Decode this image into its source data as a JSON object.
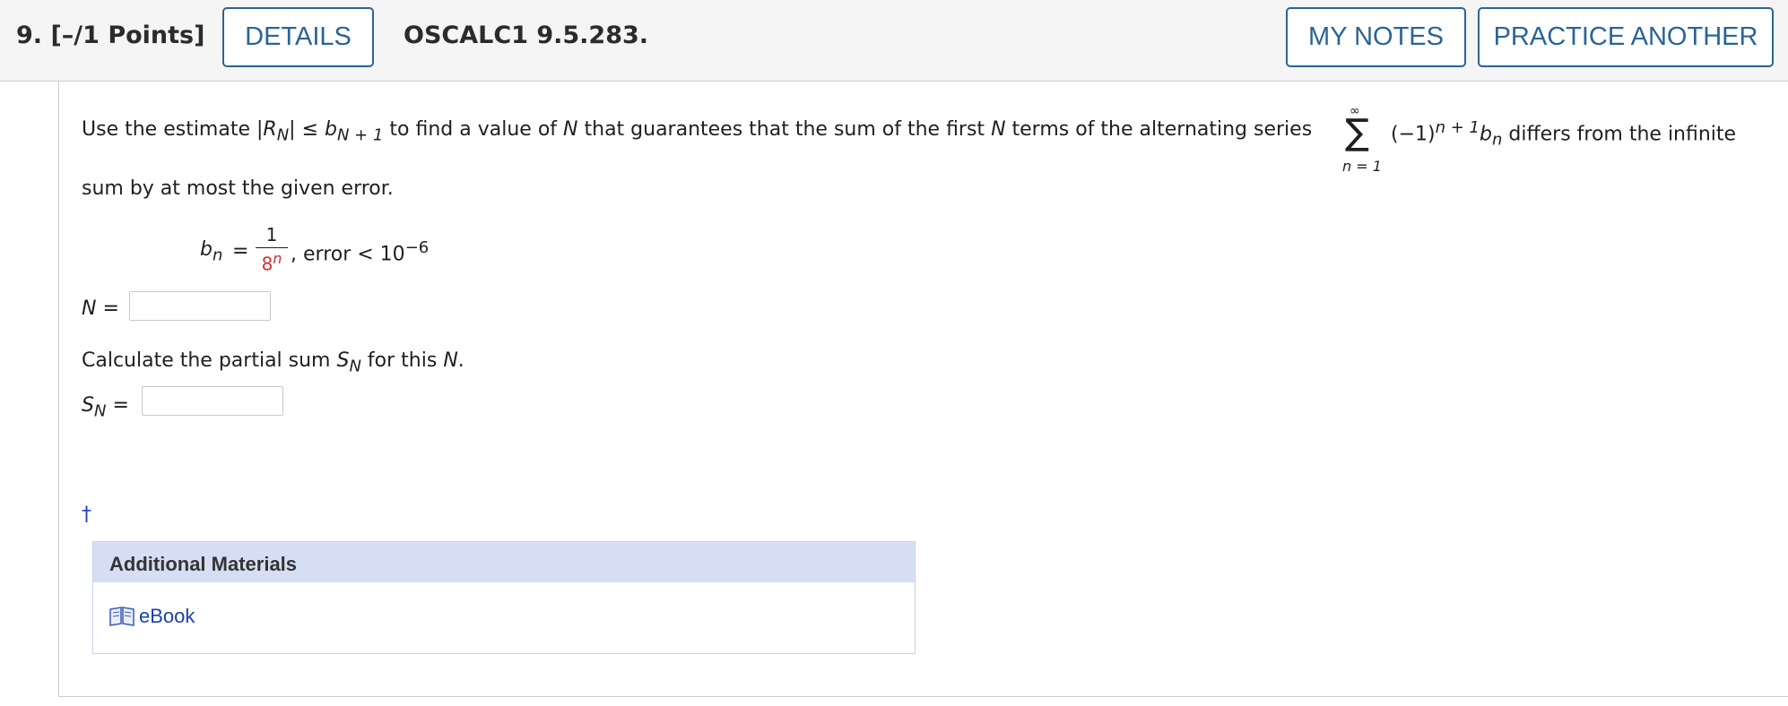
{
  "header": {
    "question_number": "9.",
    "points": "[–/1 Points]",
    "details_label": "DETAILS",
    "code": "OSCALC1 9.5.283.",
    "my_notes_label": "MY NOTES",
    "practice_label": "PRACTICE ANOTHER"
  },
  "problem": {
    "use_the_estimate": "Use the estimate |",
    "R": "R",
    "N_sub1": "N",
    "le_b": "| ≤ ",
    "b": "b",
    "N_plus_1": "N + 1",
    "to_find": " to find a value of ",
    "N1": "N",
    "guarantees": " that guarantees that the sum of the first ",
    "N2": "N",
    "terms": " terms of the alternating series",
    "sigma_top": "∞",
    "sigma": "∑",
    "sigma_bottom": "n = 1",
    "series_term": "(−1)",
    "series_exp": "n + 1",
    "series_b": "b",
    "series_b_sub": "n",
    "differs": " differs from the infinite",
    "line2": "sum by at most the given error.",
    "bn_b": "b",
    "bn_sub": "n",
    "equals": "=",
    "frac_num": "1",
    "frac_den_base": "8",
    "frac_den_exp": "n",
    "comma": ",",
    "error_text": "error < 10",
    "error_exp": "−6"
  },
  "answer1": {
    "var": "N",
    "equals": "="
  },
  "partial": {
    "text1": "Calculate the partial sum ",
    "S": "S",
    "S_sub": "N",
    "text2": " for this ",
    "N": "N",
    "period": "."
  },
  "answer2": {
    "var": "S",
    "var_sub": "N",
    "equals": "="
  },
  "dagger": "†",
  "additional": {
    "title": "Additional Materials",
    "ebook_label": "eBook"
  },
  "colors": {
    "accent": "#2a6496",
    "red": "#d32f2f",
    "link": "#1a3fb0",
    "am_header": "#d6def3"
  }
}
